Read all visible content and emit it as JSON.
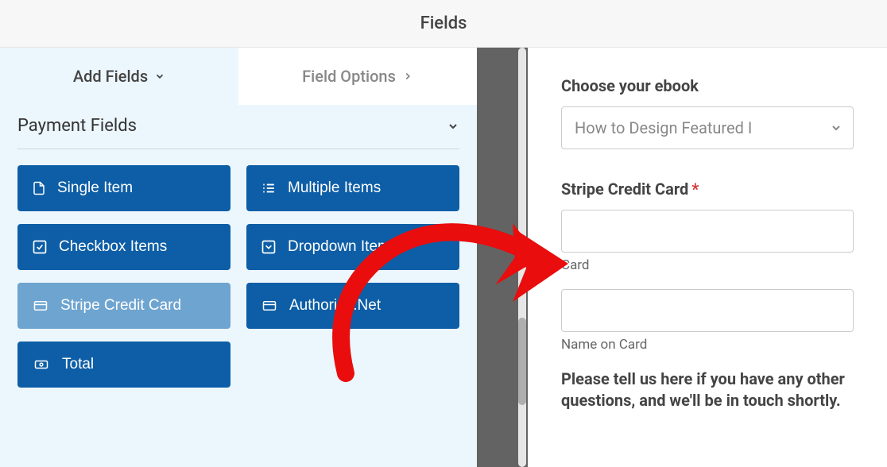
{
  "header": {
    "title": "Fields"
  },
  "tabs": {
    "add_fields": "Add Fields",
    "field_options": "Field Options"
  },
  "section": {
    "title": "Payment Fields"
  },
  "field_buttons": {
    "single_item": "Single Item",
    "multiple_items": "Multiple Items",
    "checkbox_items": "Checkbox Items",
    "dropdown_items": "Dropdown Items",
    "stripe_credit_card": "Stripe Credit Card",
    "authorize_net": "Authorize.Net",
    "total": "Total"
  },
  "preview": {
    "ebook_label": "Choose your ebook",
    "ebook_selected": "How to Design Featured I",
    "stripe_label": "Stripe Credit Card",
    "card_sub": "Card",
    "name_sub": "Name on Card",
    "footer": "Please tell us here if you have any other questions, and we'll be in touch shortly."
  }
}
